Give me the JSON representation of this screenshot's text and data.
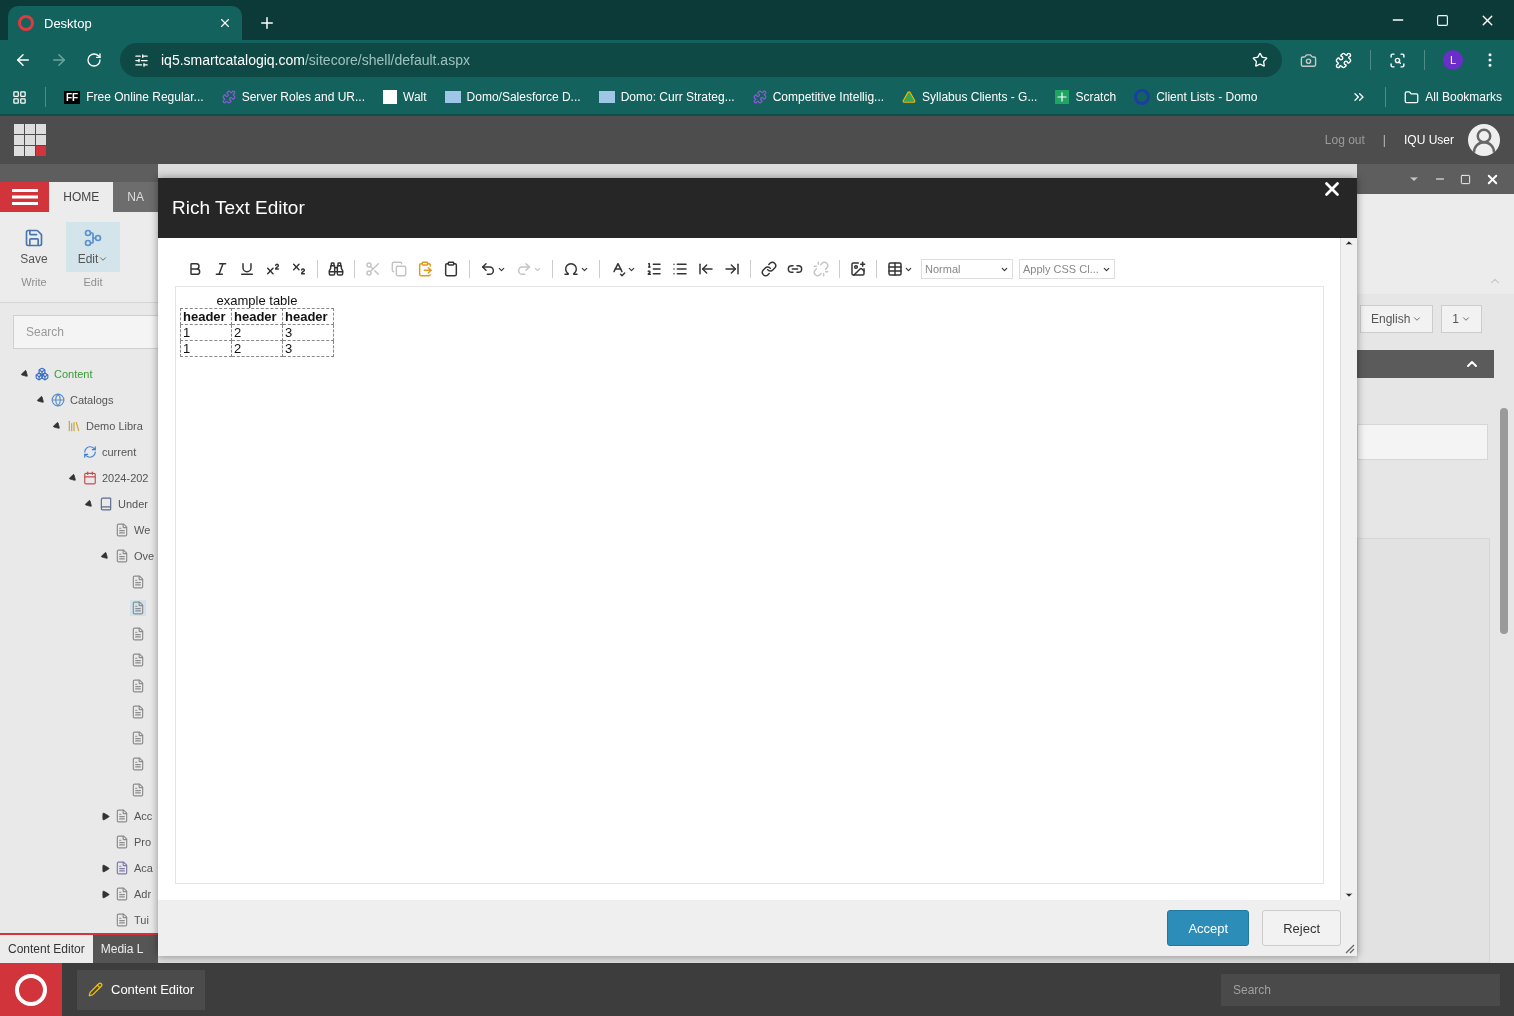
{
  "browser": {
    "tab": {
      "title": "Desktop"
    },
    "address": {
      "host": "iq5.smartcatalogiq.com",
      "path": "/sitecore/shell/default.aspx"
    },
    "profile_initial": "L",
    "bookmarks": [
      {
        "label": "Free Online Regular...",
        "kind": "ff",
        "badge": "FF"
      },
      {
        "label": "Server Roles and UR...",
        "kind": "puzzle"
      },
      {
        "label": "Walt",
        "kind": "walt"
      },
      {
        "label": "Domo/Salesforce D...",
        "kind": "domo"
      },
      {
        "label": "Domo: Curr Strateg...",
        "kind": "domo"
      },
      {
        "label": "Competitive Intellig...",
        "kind": "puzzle"
      },
      {
        "label": "Syllabus Clients - G...",
        "kind": "drive"
      },
      {
        "label": "Scratch",
        "kind": "sheet"
      },
      {
        "label": "Client Lists - Domo",
        "kind": "ring"
      }
    ],
    "all_bookmarks": "All Bookmarks"
  },
  "header": {
    "logout": "Log out",
    "separator": "|",
    "user": "IQU User"
  },
  "ribbon": {
    "tabs": [
      {
        "label": "HOME",
        "selected": true
      },
      {
        "label": "NA",
        "selected": false
      }
    ],
    "groups": [
      {
        "button": "Save",
        "caption": "Write",
        "kind": "save",
        "selected": false
      },
      {
        "button": "Edit",
        "caption": "Edit",
        "kind": "edit",
        "selected": true,
        "menu": true
      }
    ]
  },
  "search": {
    "placeholder": "Search"
  },
  "tree": [
    {
      "label": "Content",
      "kind": "content",
      "expanded": true,
      "selected": false,
      "children": [
        {
          "label": "Catalogs",
          "kind": "catalogs",
          "expanded": true,
          "selected": false,
          "children": [
            {
              "label": "Demo Libra",
              "kind": "library",
              "expanded": true,
              "selected": false,
              "children": [
                {
                  "label": "current",
                  "kind": "current",
                  "selected": false
                },
                {
                  "label": "2024-202",
                  "kind": "calendar",
                  "expanded": true,
                  "selected": false,
                  "children": [
                    {
                      "label": "Under",
                      "kind": "book",
                      "expanded": true,
                      "selected": false,
                      "children": [
                        {
                          "label": "We",
                          "kind": "page",
                          "selected": false
                        },
                        {
                          "label": "Ove",
                          "kind": "page",
                          "expanded": true,
                          "selected": false,
                          "children": [
                            {
                              "kind": "page",
                              "selected": false
                            },
                            {
                              "kind": "page",
                              "selected": true
                            },
                            {
                              "kind": "page",
                              "selected": false
                            },
                            {
                              "kind": "page",
                              "selected": false
                            },
                            {
                              "kind": "page",
                              "selected": false
                            },
                            {
                              "kind": "page",
                              "selected": false
                            },
                            {
                              "kind": "page",
                              "selected": false
                            },
                            {
                              "kind": "page",
                              "selected": false
                            },
                            {
                              "kind": "page",
                              "selected": false
                            }
                          ]
                        },
                        {
                          "label": "Acc",
                          "kind": "page",
                          "expanded": false,
                          "selected": false
                        },
                        {
                          "label": "Pro",
                          "kind": "page",
                          "selected": false
                        },
                        {
                          "label": "Aca",
                          "kind": "bundle",
                          "expanded": false,
                          "selected": false
                        },
                        {
                          "label": "Adr",
                          "kind": "page",
                          "expanded": false,
                          "selected": false
                        },
                        {
                          "label": "Tui",
                          "kind": "page",
                          "selected": false
                        }
                      ]
                    }
                  ]
                }
              ]
            }
          ]
        }
      ]
    }
  ],
  "bottom_tabs": [
    {
      "label": "Content Editor",
      "selected": true
    },
    {
      "label": "Media L",
      "selected": false
    }
  ],
  "taskbar": {
    "app": "Content Editor",
    "search_placeholder": "Search"
  },
  "right_pane": {
    "language": "English",
    "version": "1"
  },
  "dialog": {
    "title": "Rich Text Editor",
    "toolbar": [
      {
        "kind": "bold",
        "disabled": false
      },
      {
        "kind": "italic",
        "disabled": false
      },
      {
        "kind": "underline",
        "disabled": false
      },
      {
        "kind": "superscript",
        "disabled": false
      },
      {
        "kind": "subscript",
        "disabled": false
      },
      {
        "kind": "separator"
      },
      {
        "kind": "find",
        "disabled": false
      },
      {
        "kind": "separator"
      },
      {
        "kind": "cut",
        "disabled": true
      },
      {
        "kind": "copy",
        "disabled": true
      },
      {
        "kind": "paste-word",
        "disabled": false
      },
      {
        "kind": "paste",
        "disabled": false
      },
      {
        "kind": "separator"
      },
      {
        "kind": "undo",
        "disabled": false,
        "menu": true
      },
      {
        "kind": "redo",
        "disabled": true,
        "menu": true
      },
      {
        "kind": "separator"
      },
      {
        "kind": "symbol",
        "disabled": false,
        "menu": true
      },
      {
        "kind": "separator"
      },
      {
        "kind": "spell",
        "disabled": false,
        "menu": true
      },
      {
        "kind": "ordered-list",
        "disabled": false
      },
      {
        "kind": "bullet-list",
        "disabled": false
      },
      {
        "kind": "outdent",
        "disabled": false
      },
      {
        "kind": "indent",
        "disabled": false
      },
      {
        "kind": "separator"
      },
      {
        "kind": "link",
        "disabled": false
      },
      {
        "kind": "link-manager",
        "disabled": false
      },
      {
        "kind": "unlink",
        "disabled": true
      },
      {
        "kind": "separator"
      },
      {
        "kind": "image",
        "disabled": false
      },
      {
        "kind": "separator"
      },
      {
        "kind": "table",
        "disabled": false,
        "menu": true
      }
    ],
    "style_select": "Normal",
    "css_select": "Apply CSS Cl...",
    "content": {
      "caption": "example table",
      "header": [
        "header",
        "header",
        "header"
      ],
      "rows": [
        [
          "1",
          "2",
          "3"
        ],
        [
          "1",
          "2",
          "3"
        ]
      ]
    },
    "buttons": [
      {
        "label": "Accept",
        "kind": "primary"
      },
      {
        "label": "Reject",
        "kind": "secondary"
      }
    ]
  }
}
